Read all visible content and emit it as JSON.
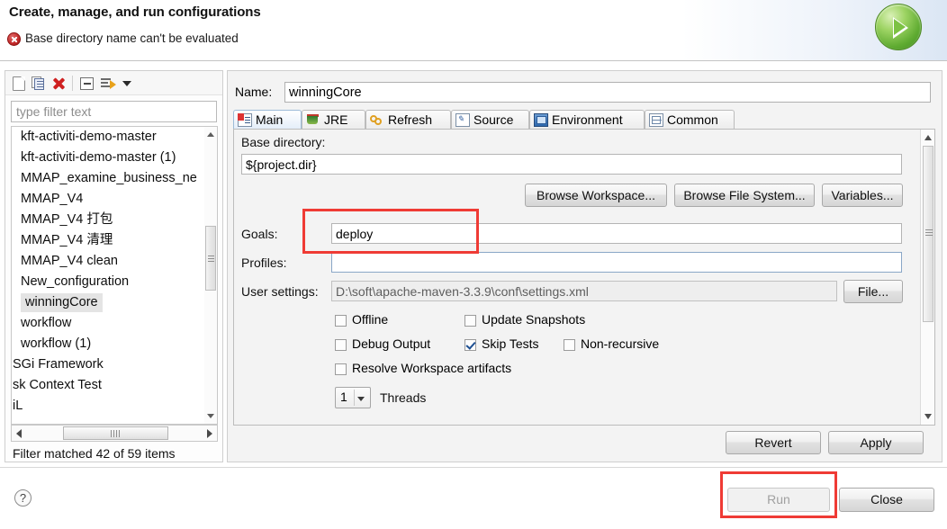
{
  "header": {
    "title": "Create, manage, and run configurations",
    "error_message": "Base directory name can't be evaluated",
    "error_icon": "error-circle-icon",
    "run_badge_icon": "run-play-icon"
  },
  "left_panel": {
    "toolbar": [
      {
        "name": "new-configuration-icon",
        "label": "New launch configuration"
      },
      {
        "name": "duplicate-configuration-icon",
        "label": "Duplicate"
      },
      {
        "name": "delete-configuration-icon",
        "label": "Delete"
      },
      {
        "name": "collapse-all-icon",
        "label": "Collapse All"
      },
      {
        "name": "filter-icon",
        "label": "Filter"
      },
      {
        "name": "view-menu-caret-icon",
        "label": "View Menu"
      }
    ],
    "filter": {
      "value": "",
      "placeholder": "type filter text"
    },
    "items": [
      {
        "label": "kft-activiti-demo-master",
        "selected": false,
        "clipped": false
      },
      {
        "label": "kft-activiti-demo-master (1)",
        "selected": false,
        "clipped": false
      },
      {
        "label": "MMAP_examine_business_ne",
        "selected": false,
        "clipped": false
      },
      {
        "label": "MMAP_V4",
        "selected": false,
        "clipped": false
      },
      {
        "label": "MMAP_V4 打包",
        "selected": false,
        "clipped": false
      },
      {
        "label": "MMAP_V4 清理",
        "selected": false,
        "clipped": false
      },
      {
        "label": "MMAP_V4 clean",
        "selected": false,
        "clipped": false
      },
      {
        "label": "New_configuration",
        "selected": false,
        "clipped": false
      },
      {
        "label": "winningCore",
        "selected": true,
        "clipped": false
      },
      {
        "label": "workflow",
        "selected": false,
        "clipped": false
      },
      {
        "label": "workflow (1)",
        "selected": false,
        "clipped": false
      },
      {
        "label": "SGi Framework",
        "selected": false,
        "clipped": true
      },
      {
        "label": "sk Context Test",
        "selected": false,
        "clipped": true
      },
      {
        "label": "iL",
        "selected": false,
        "clipped": true
      }
    ],
    "status": "Filter matched 42 of 59 items"
  },
  "right_panel": {
    "name_label": "Name:",
    "name_value": "winningCore",
    "tabs": [
      {
        "label": "Main",
        "icon": "main-tab-icon",
        "active": true
      },
      {
        "label": "JRE",
        "icon": "jre-tab-icon",
        "active": false
      },
      {
        "label": "Refresh",
        "icon": "refresh-tab-icon",
        "active": false
      },
      {
        "label": "Source",
        "icon": "source-tab-icon",
        "active": false
      },
      {
        "label": "Environment",
        "icon": "environment-tab-icon",
        "active": false
      },
      {
        "label": "Common",
        "icon": "common-tab-icon",
        "active": false
      }
    ],
    "main_tab": {
      "base_directory_label": "Base directory:",
      "base_directory_value": "${project.dir}",
      "browse_workspace_label": "Browse Workspace...",
      "browse_file_system_label": "Browse File System...",
      "variables_label": "Variables...",
      "goals_label": "Goals:",
      "goals_value": "deploy",
      "profiles_label": "Profiles:",
      "profiles_value": "",
      "user_settings_label": "User settings:",
      "user_settings_value": "D:\\soft\\apache-maven-3.3.9\\conf\\settings.xml",
      "file_button_label": "File...",
      "checkboxes": [
        {
          "label": "Offline",
          "checked": false
        },
        {
          "label": "Update Snapshots",
          "checked": false
        },
        {
          "label": "Debug Output",
          "checked": false
        },
        {
          "label": "Skip Tests",
          "checked": true
        },
        {
          "label": "Non-recursive",
          "checked": false
        },
        {
          "label": "Resolve Workspace artifacts",
          "checked": false
        }
      ],
      "threads_value": "1",
      "threads_label": "Threads"
    },
    "revert_label": "Revert",
    "apply_label": "Apply"
  },
  "footer": {
    "help_icon": "help-question-icon",
    "help_glyph": "?",
    "run_label": "Run",
    "run_disabled": true,
    "close_label": "Close"
  },
  "annotations": {
    "accent_color": "#ef3b35",
    "goals_highlight": "goals-field-highlight",
    "run_highlight": "run-button-highlight"
  }
}
